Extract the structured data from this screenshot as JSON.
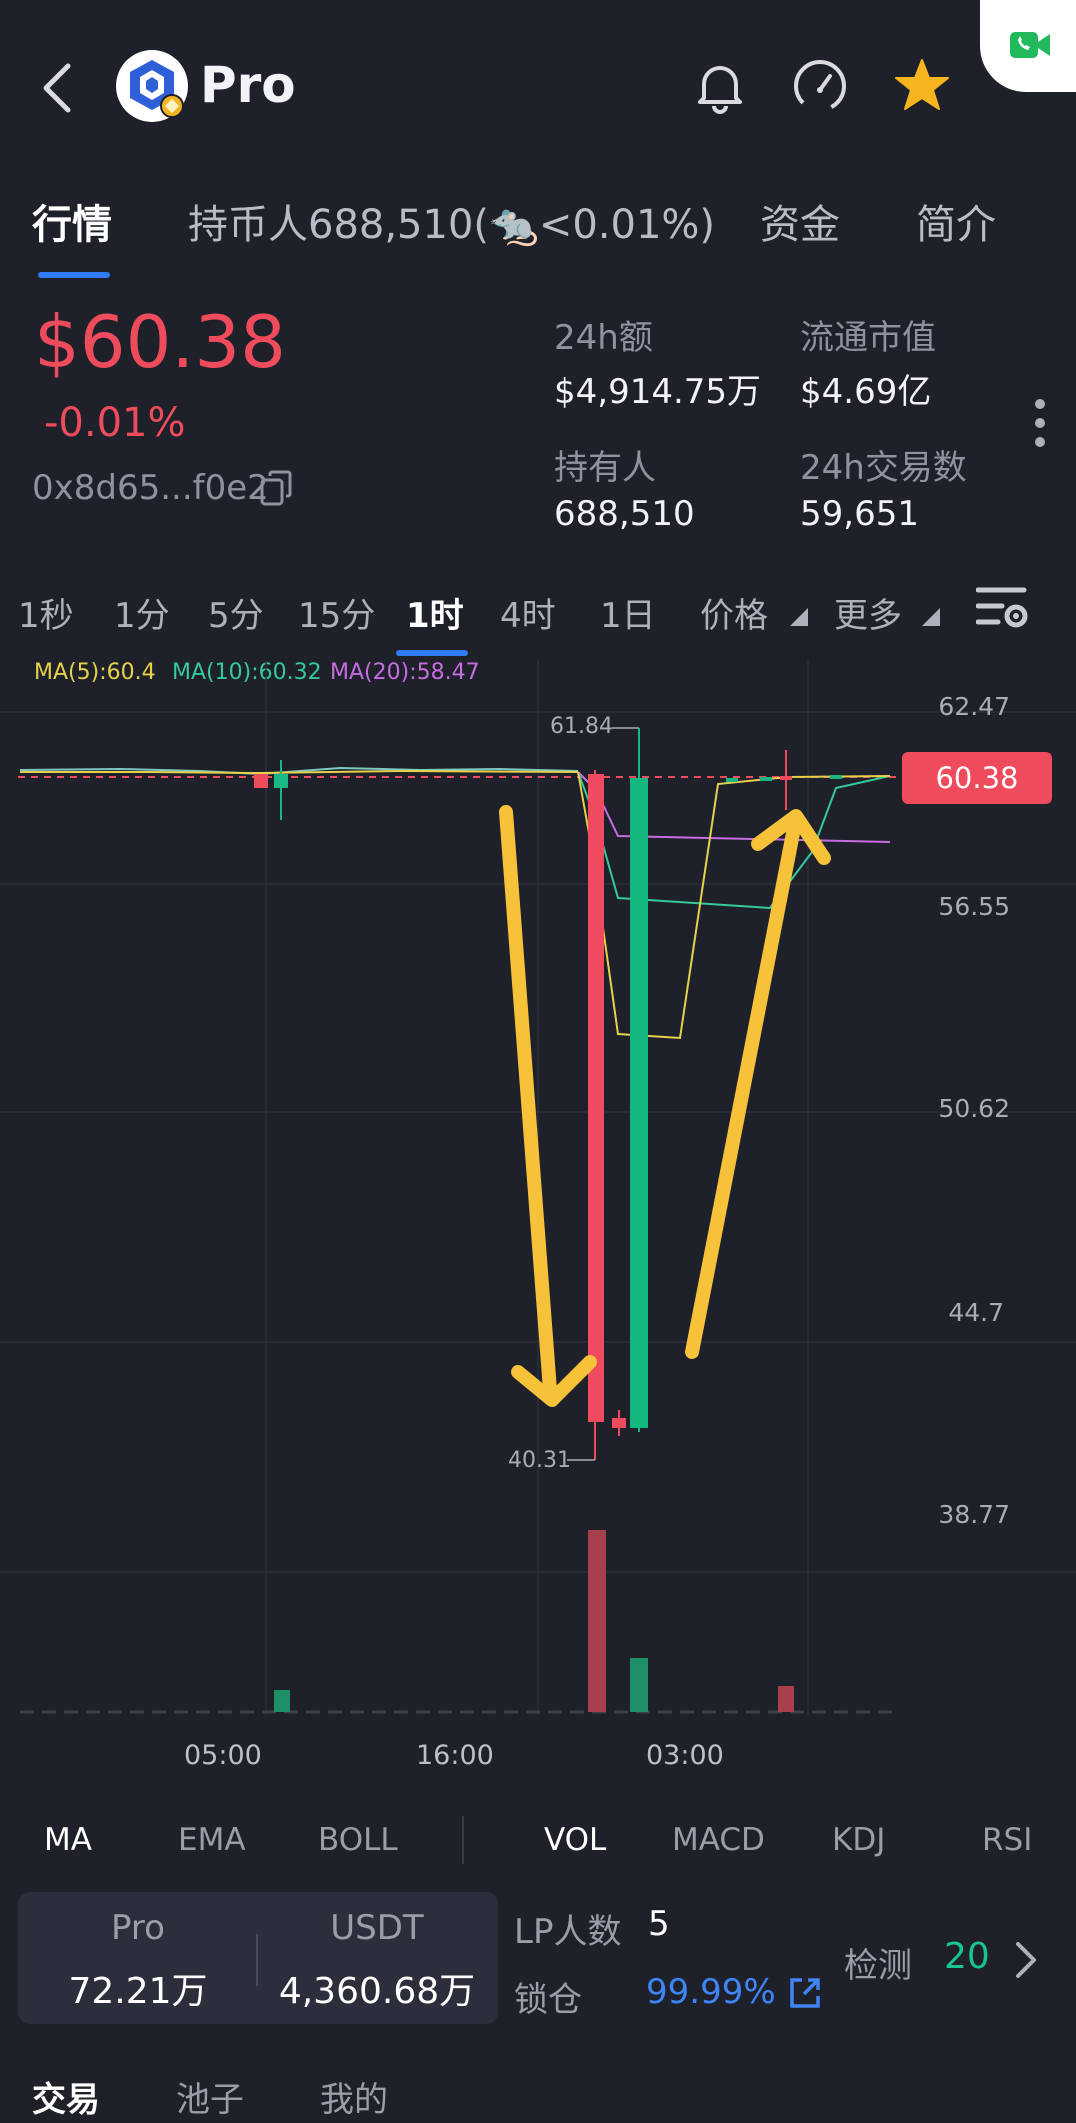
{
  "header": {
    "app_name": "Pro",
    "icons": [
      "back-icon",
      "bell-icon",
      "speedometer-icon",
      "star-icon",
      "video-call-icon"
    ]
  },
  "tabs": [
    "行情",
    "持币人688,510(🐀<0.01%)",
    "资金",
    "简介"
  ],
  "price": {
    "value": "$60.38",
    "change": "-0.01%",
    "address": "0x8d65...f0e2"
  },
  "stats": {
    "vol24_label": "24h额",
    "vol24_value": "$4,914.75万",
    "mcap_label": "流通市值",
    "mcap_value": "$4.69亿",
    "holders_label": "持有人",
    "holders_value": "688,510",
    "tx24_label": "24h交易数",
    "tx24_value": "59,651"
  },
  "intervals": [
    "1秒",
    "1分",
    "5分",
    "15分",
    "1时",
    "4时",
    "1日",
    "价格",
    "更多"
  ],
  "ma_legend": {
    "ma5": "MA(5):60.4",
    "ma10": "MA(10):60.32",
    "ma20": "MA(20):58.47"
  },
  "chart": {
    "y_ticks": [
      "62.47",
      "56.55",
      "50.62",
      "44.7",
      "38.77"
    ],
    "x_ticks": [
      "05:00",
      "16:00",
      "03:00"
    ],
    "high_label": "61.84",
    "low_label": "40.31",
    "current_price": "60.38"
  },
  "chart_data": {
    "type": "candlestick",
    "x_ticks": [
      "05:00",
      "16:00",
      "03:00"
    ],
    "ylim": [
      38.77,
      62.47
    ],
    "y_ticks": [
      62.47,
      56.55,
      50.62,
      44.7,
      38.77
    ],
    "current_price": 60.38,
    "high": 61.84,
    "low": 40.31,
    "series": [
      {
        "name": "MA(5)",
        "last": 60.4
      },
      {
        "name": "MA(10)",
        "last": 60.32
      },
      {
        "name": "MA(20)",
        "last": 58.47
      }
    ],
    "colors": {
      "up": "#18b784",
      "down": "#ee4b5c",
      "ma5": "#e8d14a",
      "ma10": "#36c99a",
      "ma20": "#c66de0"
    }
  },
  "indicators": [
    "MA",
    "EMA",
    "BOLL",
    "VOL",
    "MACD",
    "KDJ",
    "RSI"
  ],
  "pool": {
    "token_name": "Pro",
    "token_amount": "72.21万",
    "quote_name": "USDT",
    "quote_amount": "4,360.68万",
    "lp_label": "LP人数",
    "lp_value": "5",
    "lock_label": "锁仓",
    "lock_value": "99.99%",
    "check_label": "检测",
    "check_value": "20"
  },
  "bottom_tabs": [
    "交易",
    "池子",
    "我的"
  ]
}
